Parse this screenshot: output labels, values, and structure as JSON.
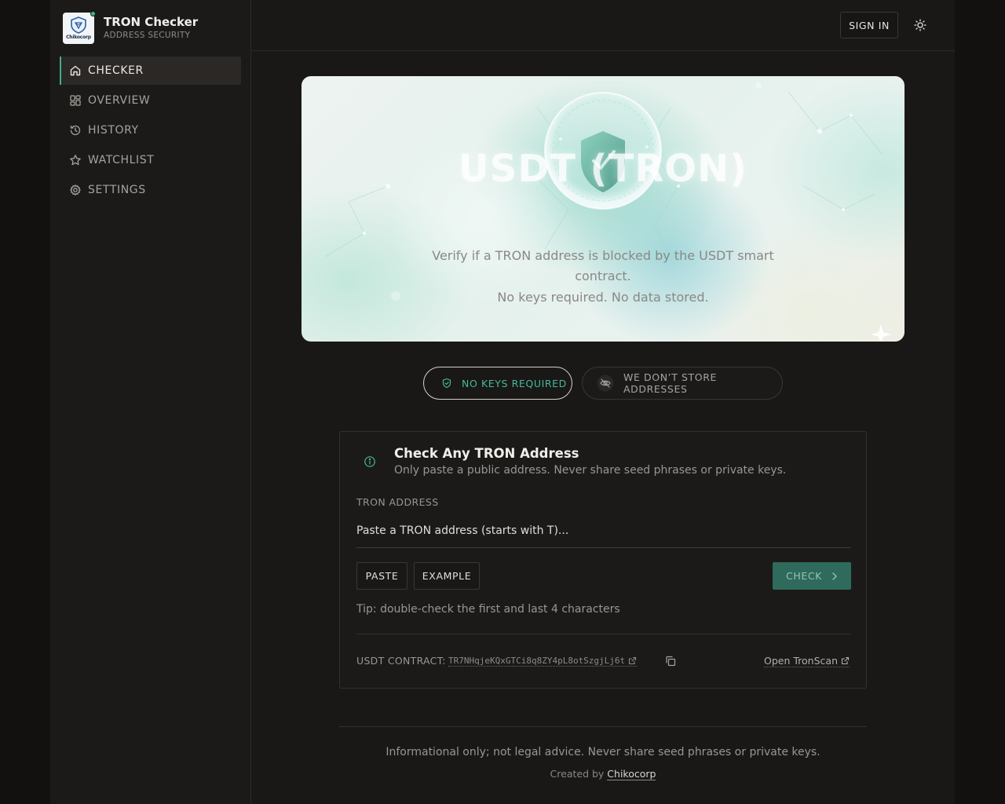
{
  "brand": {
    "logo_text": "Chikocorp",
    "title": "TRON Checker",
    "subtitle": "ADDRESS SECURITY"
  },
  "sidebar": {
    "items": [
      {
        "label": "CHECKER",
        "icon": "home-icon",
        "active": true
      },
      {
        "label": "OVERVIEW",
        "icon": "grid-icon",
        "active": false
      },
      {
        "label": "HISTORY",
        "icon": "history-icon",
        "active": false
      },
      {
        "label": "WATCHLIST",
        "icon": "star-icon",
        "active": false
      },
      {
        "label": "SETTINGS",
        "icon": "gear-icon",
        "active": false
      }
    ]
  },
  "header": {
    "sign_in_label": "SIGN IN",
    "theme_icon": "sun-icon"
  },
  "hero": {
    "title": "USDT (TRON)",
    "description": "Verify if a TRON address is blocked by the USDT smart contract.",
    "note": "No keys required. No data stored."
  },
  "badges": {
    "keys": "NO KEYS REQUIRED",
    "store": "WE DON’T STORE ADDRESSES"
  },
  "checker": {
    "title": "Check Any TRON Address",
    "subtitle": "Only paste a public address. Never share seed phrases or private keys.",
    "field_label": "TRON ADDRESS",
    "placeholder": "Paste a TRON address (starts with T)...",
    "value": "",
    "paste_label": "PASTE",
    "example_label": "EXAMPLE",
    "check_label": "CHECK",
    "tip": "Tip: double-check the first and last 4 characters",
    "contract_label": "USDT CONTRACT:",
    "contract_address": "TR7NHqjeKQxGTCi8q8ZY4pL8otSzgjLj6t",
    "tronscan_label": "Open TronScan"
  },
  "footer": {
    "disclaimer": "Informational only; not legal advice. Never share seed phrases or private keys.",
    "credit_prefix": "Created by",
    "credit_link": "Chikocorp"
  },
  "colors": {
    "accent": "#3fae8f",
    "check_button": "#2e6b5c",
    "background": "#1a1817"
  }
}
